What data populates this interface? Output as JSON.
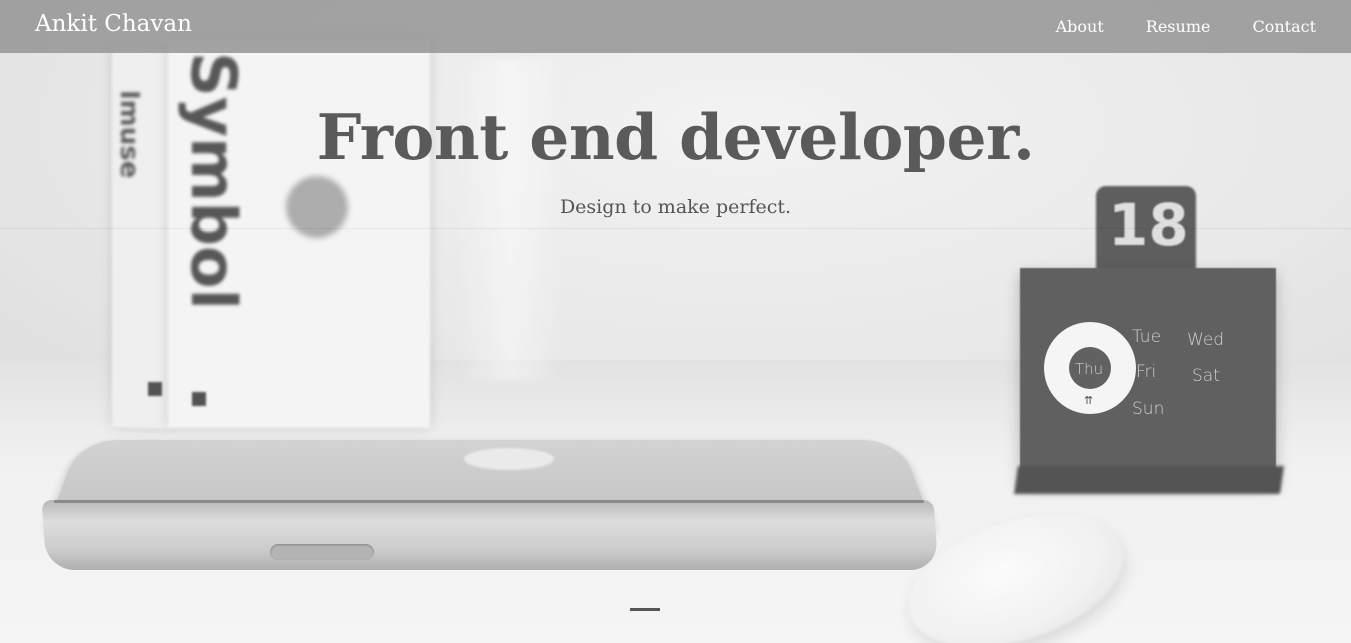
{
  "navbar": {
    "brand": "Ankit Chavan",
    "links": [
      {
        "label": "About"
      },
      {
        "label": "Resume"
      },
      {
        "label": "Contact"
      }
    ]
  },
  "hero": {
    "title": "Front end developer.",
    "subtitle": "Design to make perfect."
  },
  "background_photo": {
    "book_spine_text": [
      "Symbol",
      "Imuse"
    ],
    "calendar": {
      "date": "18",
      "days": [
        "Thu",
        "Tue",
        "Wed",
        "Fri",
        "Sat",
        "Sun"
      ]
    }
  }
}
